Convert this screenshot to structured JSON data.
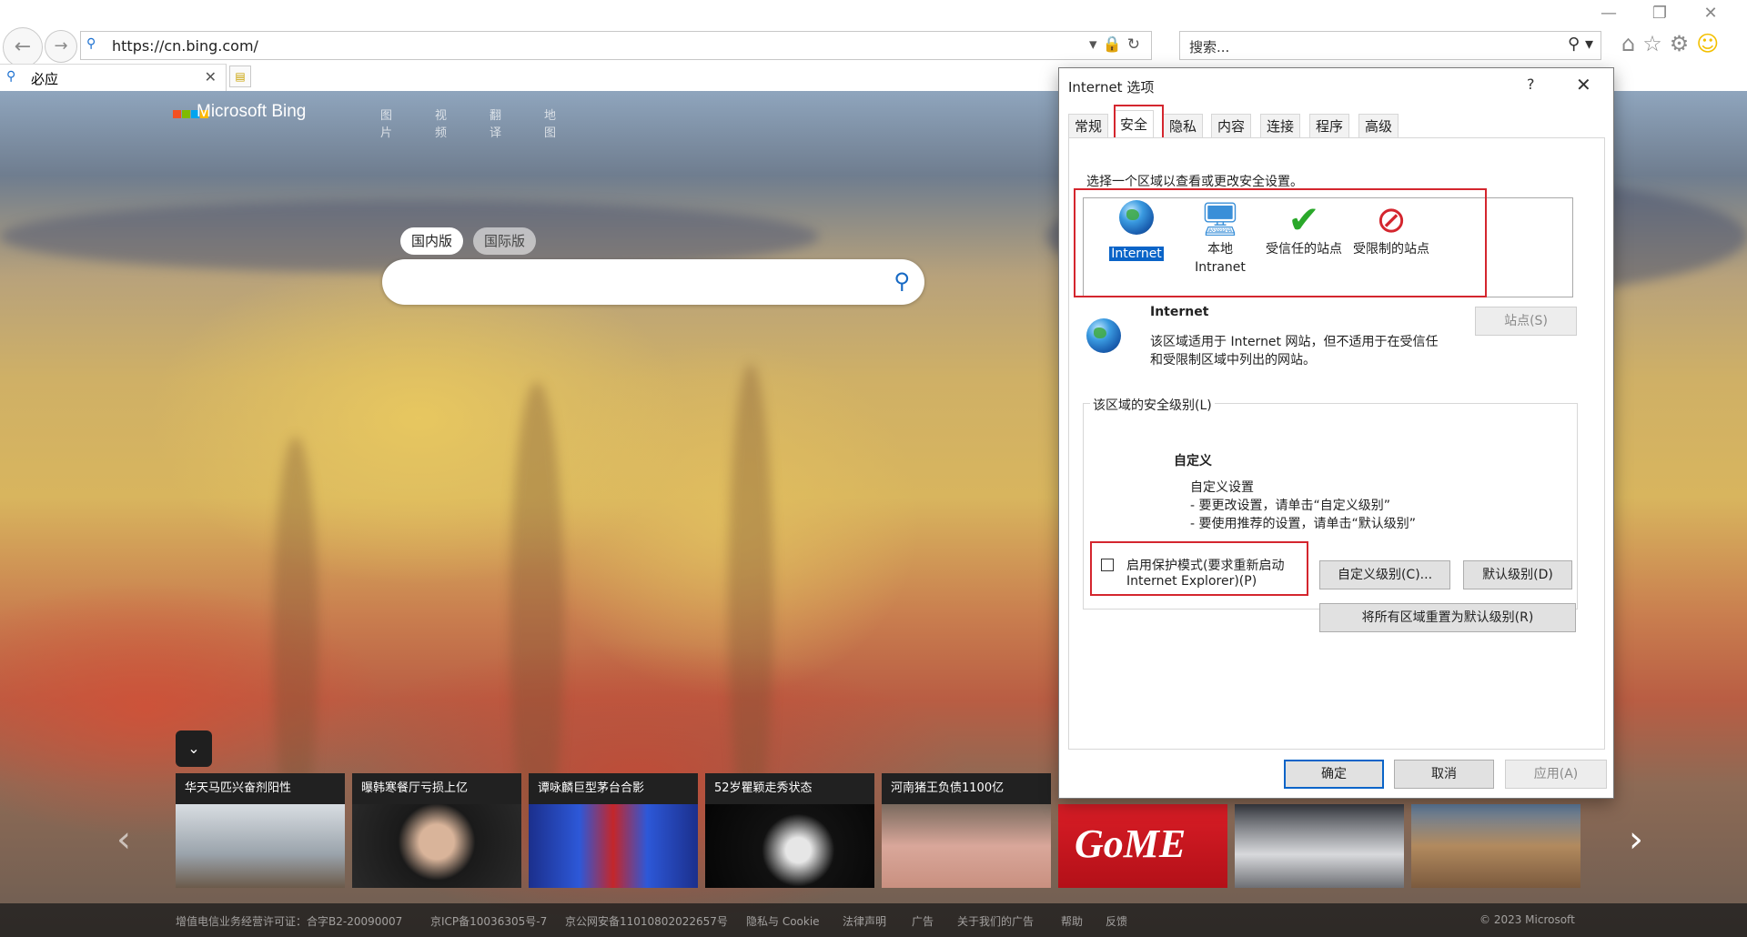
{
  "browser": {
    "address": "https://cn.bing.com/",
    "search_placeholder": "搜索...",
    "tab_title": "必应"
  },
  "bing": {
    "logo": "Microsoft Bing",
    "nav": [
      "图片",
      "视频",
      "翻译",
      "地图"
    ],
    "region_cn": "国内版",
    "region_intl": "国际版",
    "cards": [
      "华天马匹兴奋剂阳性",
      "曝韩寒餐厅亏损上亿",
      "谭咏麟巨型茅台合影",
      "52岁瞿颖走秀状态",
      "河南猪王负债1100亿",
      "",
      "",
      ""
    ],
    "footer": [
      "增值电信业务经营许可证：合字B2-20090007",
      "京ICP备10036305号-7",
      "京公网安备11010802022657号",
      "隐私与 Cookie",
      "法律声明",
      "广告",
      "关于我们的广告",
      "帮助",
      "反馈",
      "© 2023 Microsoft"
    ]
  },
  "dialog": {
    "title": "Internet 选项",
    "help": "?",
    "tabs": [
      "常规",
      "安全",
      "隐私",
      "内容",
      "连接",
      "程序",
      "高级"
    ],
    "active_tab": "安全",
    "zone_prompt": "选择一个区域以查看或更改安全设置。",
    "zones": [
      {
        "line1": "Internet",
        "line2": ""
      },
      {
        "line1": "本地",
        "line2": "Intranet"
      },
      {
        "line1": "受信任的站点",
        "line2": ""
      },
      {
        "line1": "受限制的站点",
        "line2": ""
      }
    ],
    "zone_heading": "Internet",
    "zone_desc_1": "该区域适用于 Internet 网站，但不适用于在受信任",
    "zone_desc_2": "和受限制区域中列出的网站。",
    "sites_button": "站点(S)",
    "level_group_label": "该区域的安全级别(L)",
    "level_name": "自定义",
    "level_line1": "自定义设置",
    "level_line2": "- 要更改设置，请单击“自定义级别”",
    "level_line3": "- 要使用推荐的设置，请单击“默认级别”",
    "protected_mode_1": "启用保护模式(要求重新启动",
    "protected_mode_2": "Internet Explorer)(P)",
    "protected_mode_checked": false,
    "custom_level_button": "自定义级别(C)...",
    "default_level_button": "默认级别(D)",
    "reset_all_button": "将所有区域重置为默认级别(R)",
    "ok_button": "确定",
    "cancel_button": "取消",
    "apply_button": "应用(A)"
  },
  "colors": {
    "highlight_box": "#d4262e",
    "selection": "#0a64c8",
    "link_blue": "#1669c4"
  }
}
